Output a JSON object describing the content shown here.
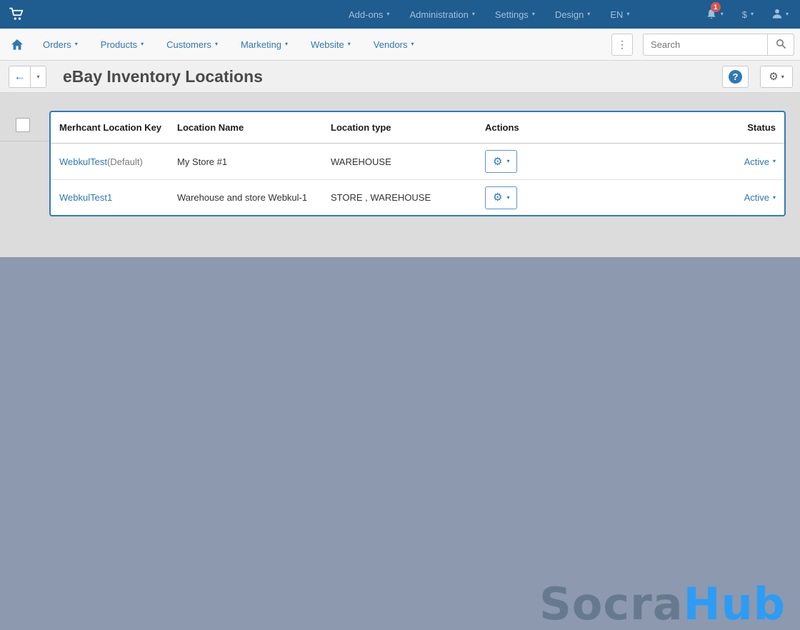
{
  "topbar": {
    "menus": [
      "Add-ons",
      "Administration",
      "Settings",
      "Design",
      "EN"
    ],
    "notification_count": "1",
    "currency_label": "$"
  },
  "navbar": {
    "items": [
      "Orders",
      "Products",
      "Customers",
      "Marketing",
      "Website",
      "Vendors"
    ],
    "search_placeholder": "Search"
  },
  "header": {
    "title": "eBay Inventory Locations"
  },
  "table": {
    "columns": [
      "Merhcant Location Key",
      "Location Name",
      "Location type",
      "Actions",
      "Status"
    ],
    "rows": [
      {
        "key": "WebkulTest",
        "key_suffix": "(Default)",
        "name": "My Store #1",
        "type": "WAREHOUSE",
        "status": "Active"
      },
      {
        "key": "WebkulTest1",
        "key_suffix": "",
        "name": "Warehouse and store Webkul-1",
        "type": "STORE , WAREHOUSE",
        "status": "Active"
      }
    ]
  },
  "watermark": {
    "part1": "Socra",
    "part2": "Hub"
  },
  "colors": {
    "topbar_bg": "#1f5c90",
    "accent_blue": "#3077b5",
    "highlight_border": "#2f7cb4",
    "watermark_blue": "#2d9cf5",
    "badge_red": "#d9534f",
    "page_bg": "#8c99af",
    "content_bg": "#dcdcdc"
  }
}
